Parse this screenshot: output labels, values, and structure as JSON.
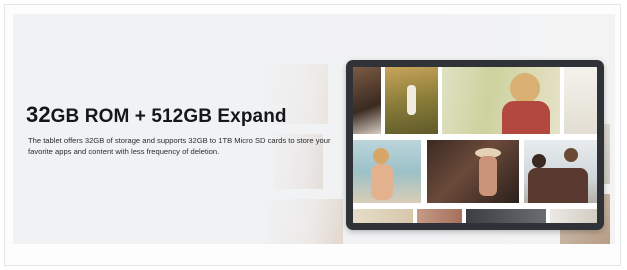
{
  "banner": {
    "headline_num": "32",
    "headline_rest": "GB ROM + 512GB Expand",
    "description": "The tablet offers 32GB of storage and supports 32GB to 1TB Micro SD cards to store your favorite apps and content with less frequency of deletion."
  },
  "colors": {
    "background": "#f1f2f4",
    "tablet_bezel": "#2f3237",
    "headline": "#15171a"
  }
}
